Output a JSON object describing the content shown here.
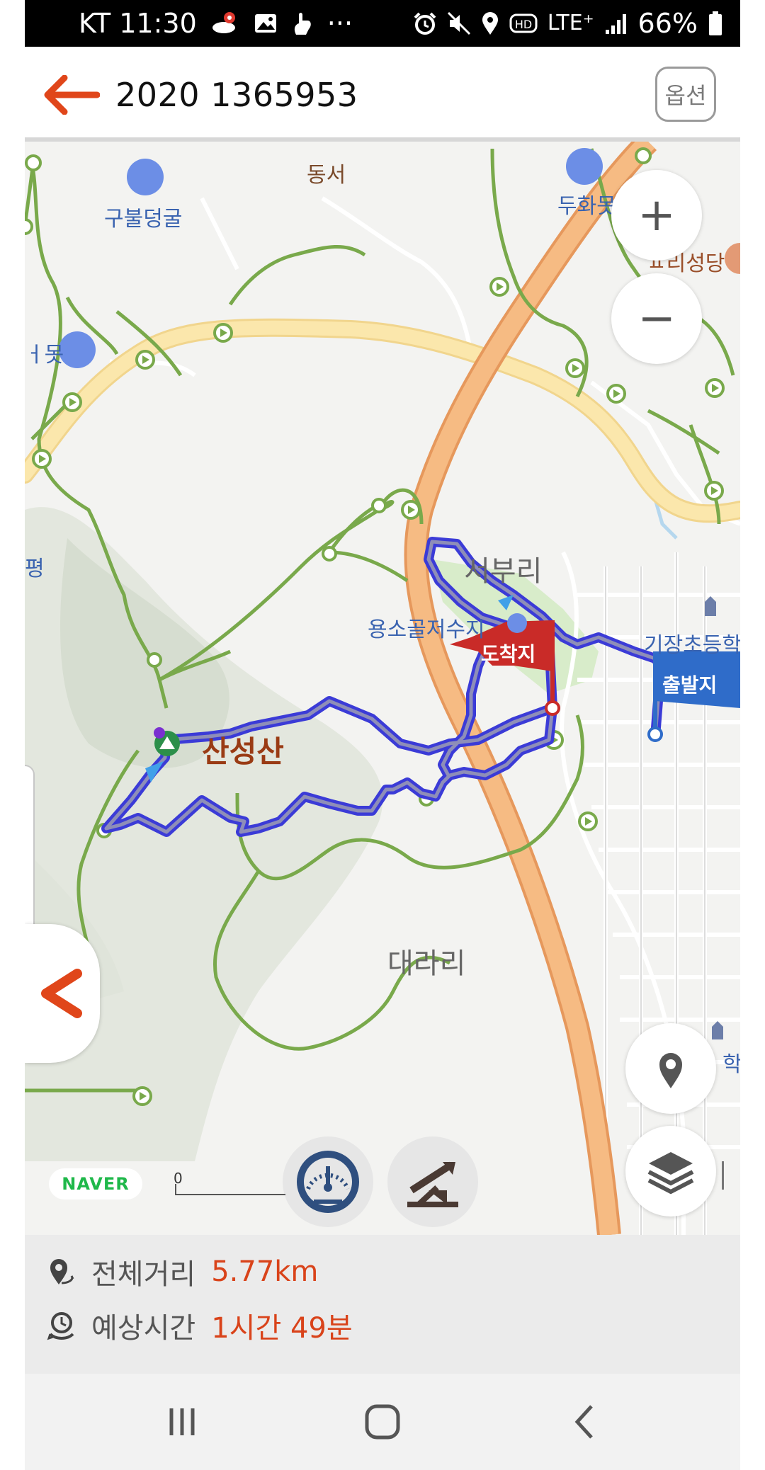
{
  "status_bar": {
    "carrier_time": "KT 11:30",
    "notif_icons": [
      "map-pin-app-icon",
      "image-icon",
      "hand-icon",
      "more-dots-icon"
    ],
    "more": "···",
    "right_icons": [
      "alarm-icon",
      "mute-icon",
      "location-icon",
      "hd-icon",
      "lte-icon",
      "signal-icon"
    ],
    "lte": "LTE⁺",
    "battery_percent": "66%"
  },
  "header": {
    "title": "2020 1365953",
    "options_label": "옵션"
  },
  "map": {
    "labels": {
      "gubul_cave": "구불덩굴",
      "dongseo": "동서",
      "duhwa": "두화못",
      "church": "ㅍ리성당",
      "pond_left": "ㅓ못",
      "seoburi": "서부리",
      "reservoir": "용소골저수지",
      "school_top": "기장초등학",
      "left_edge": "평",
      "sanseongsan": "산성산",
      "daerari": "대라리",
      "school_bottom": "학"
    },
    "markers": {
      "arrival": "도착지",
      "departure": "출발지"
    },
    "zoom_in": "+",
    "zoom_out": "−",
    "scale_zero": "0",
    "naver_logo": "NAVER",
    "colors": {
      "route": "#3a3adc",
      "arrival_flag": "#c92b28",
      "departure_flag": "#2f6cc9",
      "highway": "#f4b277",
      "road_yellow": "#fbe3a0",
      "trail": "#76a84a"
    }
  },
  "info": {
    "distance_label": "전체거리",
    "distance_value": "5.77km",
    "time_label": "예상시간",
    "time_value": "1시간 49분"
  },
  "nav": {
    "recent_icon": "recent-apps-icon",
    "home_icon": "home-icon",
    "back_icon": "back-icon"
  }
}
